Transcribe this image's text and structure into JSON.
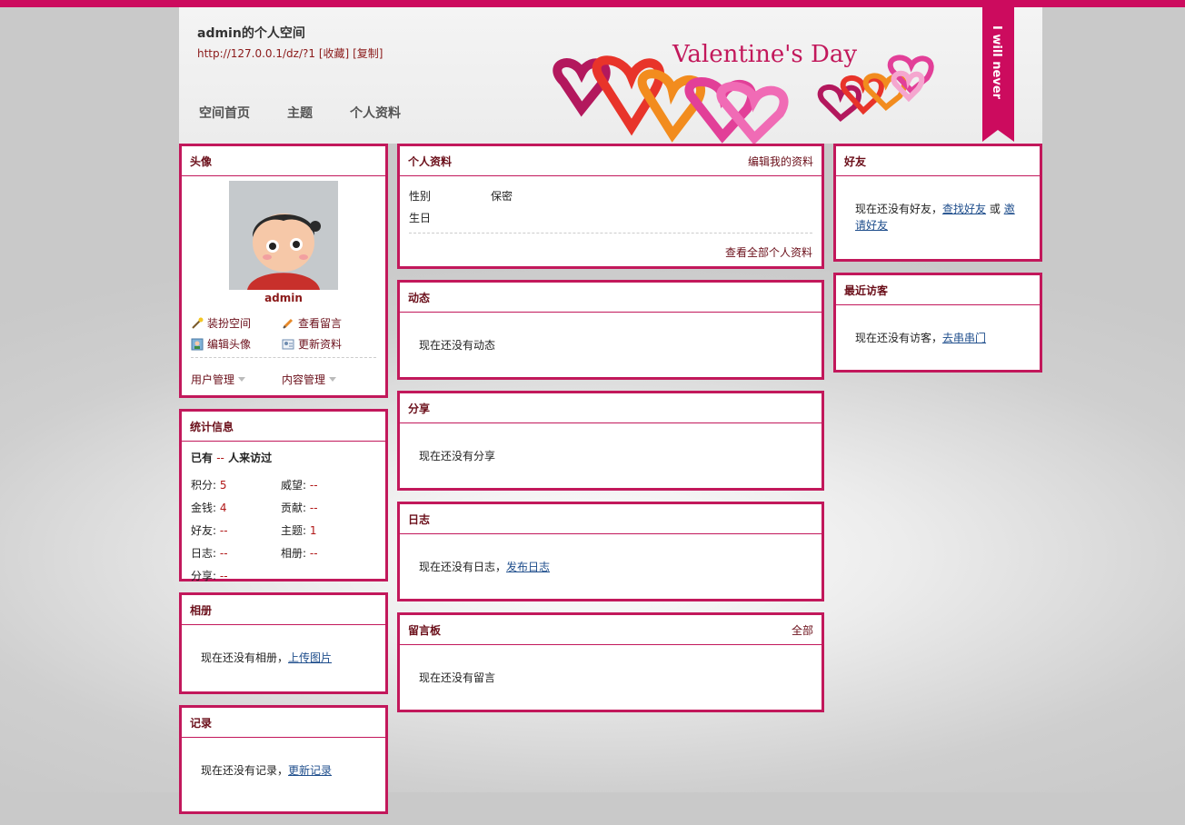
{
  "header": {
    "title": "admin的个人空间",
    "url": "http://127.0.0.1/dz/?1",
    "bookmark": "[收藏]",
    "copy": "[复制]",
    "banner_text": "Valentine's Day",
    "ribbon_text": "I will never"
  },
  "nav": {
    "home": "空间首页",
    "topics": "主题",
    "profile": "个人资料"
  },
  "avatar_box": {
    "title": "头像",
    "username": "admin",
    "actions": [
      "装扮空间",
      "查看留言",
      "编辑头像",
      "更新资料"
    ],
    "user_mgmt": "用户管理",
    "content_mgmt": "内容管理"
  },
  "stats": {
    "title": "统计信息",
    "visitors_prefix": "已有",
    "visitors_value": "--",
    "visitors_suffix": "人来访过",
    "items": [
      {
        "label": "积分: ",
        "value": "5"
      },
      {
        "label": "威望: ",
        "value": "--"
      },
      {
        "label": "金钱: ",
        "value": "4"
      },
      {
        "label": "贡献: ",
        "value": "--"
      },
      {
        "label": "好友: ",
        "value": "--"
      },
      {
        "label": "主题: ",
        "value": "1"
      },
      {
        "label": "日志: ",
        "value": "--"
      },
      {
        "label": "相册: ",
        "value": "--"
      },
      {
        "label": "分享: ",
        "value": "--"
      }
    ]
  },
  "album": {
    "title": "相册",
    "text": "现在还没有相册，",
    "link": "上传图片"
  },
  "records": {
    "title": "记录",
    "text": "现在还没有记录，",
    "link": "更新记录"
  },
  "profile": {
    "title": "个人资料",
    "edit": "编辑我的资料",
    "gender_label": "性别",
    "gender_value": "保密",
    "birthday_label": "生日",
    "view_all": "查看全部个人资料"
  },
  "feed": {
    "title": "动态",
    "text": "现在还没有动态"
  },
  "share": {
    "title": "分享",
    "text": "现在还没有分享"
  },
  "blog": {
    "title": "日志",
    "text": "现在还没有日志，",
    "link": "发布日志"
  },
  "guestbook": {
    "title": "留言板",
    "all": "全部",
    "text": "现在还没有留言"
  },
  "friends": {
    "title": "好友",
    "text": "现在还没有好友，",
    "find": "查找好友",
    "or": "或",
    "invite_1": "邀",
    "invite_2": "请好友"
  },
  "visitors": {
    "title": "最近访客",
    "text": "现在还没有访客，",
    "link": "去串串门"
  },
  "colors": {
    "accent": "#c2185b",
    "topbar": "#cc0b5e",
    "title_text": "#6b0f1a"
  }
}
